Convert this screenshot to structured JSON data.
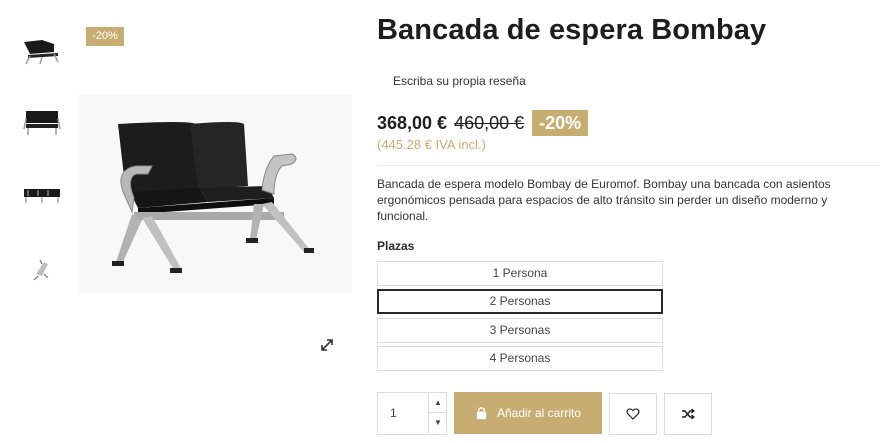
{
  "thumbnails": [
    {
      "icon": "bench-angle-thumbnail"
    },
    {
      "icon": "bench-front-thumbnail"
    },
    {
      "icon": "bench-row-thumbnail"
    },
    {
      "icon": "bench-detail-thumbnail"
    }
  ],
  "image_badge": "-20%",
  "product": {
    "title": "Bancada de espera Bombay",
    "review_link": "Escriba su propia reseña",
    "price": "368,00 €",
    "old_price": "460,00 €",
    "discount": "-20%",
    "tax_note": "(445.28 € IVA incl.)",
    "description": "Bancada de espera modelo Bombay de Euromof. Bombay una bancada con asientos ergonómicos pensada para espacios de alto tránsito sin perder un diseño moderno y funcional."
  },
  "variant": {
    "label": "Plazas",
    "options": [
      "1 Persona",
      "2 Personas",
      "3 Personas",
      "4 Personas"
    ],
    "selected": "2 Personas"
  },
  "cart": {
    "quantity": "1",
    "add_label": "Añadir al carrito",
    "up_arrow": "▲",
    "down_arrow": "▼"
  },
  "colors": {
    "accent": "#c7ad72",
    "text": "#1e1e1e"
  }
}
